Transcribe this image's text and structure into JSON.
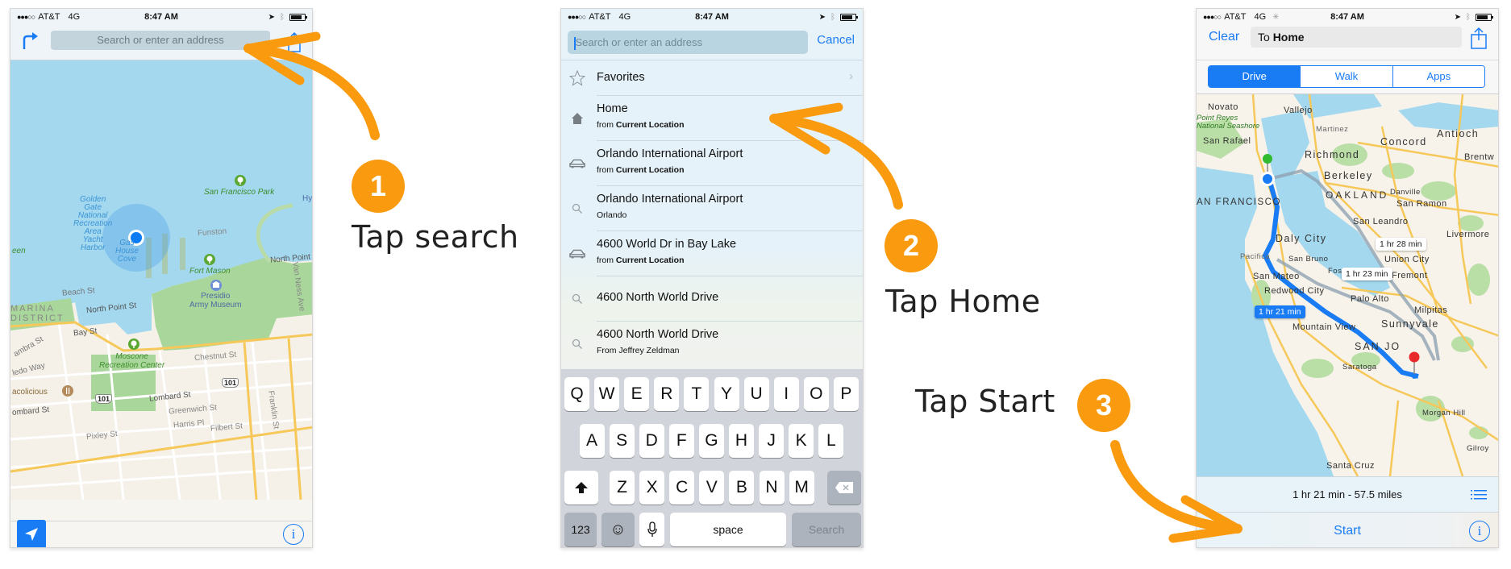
{
  "colors": {
    "accent_orange": "#f99a0f",
    "ios_blue": "#1a7cf5",
    "water": "#a3d8ef",
    "land": "#f7f3ea",
    "park": "#a9d69a",
    "road": "#f6c85a"
  },
  "status_bar": {
    "signal": "●●●○○",
    "carrier": "AT&T",
    "network": "4G",
    "time": "8:47 AM"
  },
  "steps": [
    {
      "number": "1",
      "label": "Tap search"
    },
    {
      "number": "2",
      "label": "Tap Home"
    },
    {
      "number": "3",
      "label": "Tap Start"
    }
  ],
  "screen1": {
    "search_placeholder": "Search or enter an address",
    "map_labels": {
      "golden_gate": "Golden Gate National Recreation Area Yacht Harbor",
      "golden_gate_lines": [
        "Golden",
        "Gate",
        "National",
        "Recreation",
        "Area",
        "Yacht",
        "Harbor"
      ],
      "gas_house_lines": [
        "Gas",
        "House",
        "Cove"
      ],
      "sf_park": "San Francisco Park",
      "funston": "Funston",
      "fort_mason": "Fort Mason",
      "museum_lines": [
        "Presidio",
        "Army Museum"
      ],
      "marina_lines": [
        "MARINA",
        "DISTRICT"
      ],
      "beach_st": "Beach St",
      "north_point_st": "North Point St",
      "north_point_st_2": "North Point St",
      "bay_st": "Bay St",
      "alhambra_st": "ambra St",
      "toledo_way": "ledo Way",
      "moscone_lines": [
        "Moscone",
        "Recreation Center"
      ],
      "chestnut_st": "Chestnut St",
      "tacolicious": "acolicious",
      "lombard_st": "Lombard St",
      "lombard_st_2": "ombard St",
      "greenwich_st": "Greenwich St",
      "harris_pl": "Harris Pl",
      "filbert_st": "Filbert St",
      "pixley_st": "Pixley St",
      "franklin_st": "Franklin St",
      "van_ness_ave": "Van Ness Ave",
      "hy": "Hy",
      "hwy_101": "101",
      "een": "een"
    }
  },
  "screen2": {
    "search_placeholder": "Search or enter an address",
    "cancel_label": "Cancel",
    "rows": [
      {
        "icon": "star",
        "title": "Favorites",
        "sub_prefix": "",
        "sub_bold": "",
        "chevron": true
      },
      {
        "icon": "home",
        "title": "Home",
        "sub_prefix": "from ",
        "sub_bold": "Current Location"
      },
      {
        "icon": "car",
        "title": "Orlando International Airport",
        "sub_prefix": "from ",
        "sub_bold": "Current Location"
      },
      {
        "icon": "search",
        "title": "Orlando International Airport",
        "sub_prefix": "Orlando",
        "sub_bold": ""
      },
      {
        "icon": "car",
        "title": "4600 World Dr in Bay Lake",
        "sub_prefix": "from ",
        "sub_bold": "Current Location"
      },
      {
        "icon": "search",
        "title": "4600 North World Drive",
        "sub_prefix": "",
        "sub_bold": ""
      },
      {
        "icon": "search",
        "title": "4600 North World Drive",
        "sub_prefix": "From Jeffrey Zeldman",
        "sub_bold": ""
      }
    ],
    "keyboard": {
      "row1": [
        "Q",
        "W",
        "E",
        "R",
        "T",
        "Y",
        "U",
        "I",
        "O",
        "P"
      ],
      "row2": [
        "A",
        "S",
        "D",
        "F",
        "G",
        "H",
        "J",
        "K",
        "L"
      ],
      "row3": [
        "Z",
        "X",
        "C",
        "V",
        "B",
        "N",
        "M"
      ],
      "numbers_label": "123",
      "space_label": "space",
      "search_label": "Search"
    }
  },
  "screen3": {
    "clear_label": "Clear",
    "route_prefix": "To ",
    "route_dest": "Home",
    "segments": [
      {
        "label": "Drive",
        "active": true
      },
      {
        "label": "Walk",
        "active": false
      },
      {
        "label": "Apps",
        "active": false
      }
    ],
    "cities": {
      "novato": "Novato",
      "vallejo": "Vallejo",
      "point_reyes": "Point Reyes",
      "national_seashore": "National Seashore",
      "san_rafael": "San Rafael",
      "martinez": "Martinez",
      "antioch": "Antioch",
      "concord": "Concord",
      "richmond": "Richmond",
      "brentwood": "Brentw",
      "berkeley": "Berkeley",
      "san_francisco": "AN FRANCISCO",
      "oakland": "OAKLAND",
      "danville": "Danville",
      "san_ramon": "San Ramon",
      "san_leandro": "San Leandro",
      "daly_city": "Daly City",
      "livermore": "Livermore",
      "pacifica": "Pacifica",
      "san_bruno": "San Bruno",
      "union_city": "Union City",
      "san_mateo": "San Mateo",
      "foster_city": "Foster City",
      "fremont": "Fremont",
      "redwood_city": "Redwood City",
      "palo_alto": "Palo Alto",
      "milpitas": "Milpitas",
      "mountain_view": "Mountain View",
      "sunnyvale": "Sunnyvale",
      "san_jose": "SAN JO",
      "saratoga": "Saratoga",
      "morgan_hill": "Morgan Hill",
      "gilroy": "Gilroy",
      "santa_cruz": "Santa Cruz"
    },
    "route_times": {
      "alt1": "1 hr 28 min",
      "alt2": "1 hr 23 min",
      "selected": "1 hr 21 min"
    },
    "summary": "1 hr 21 min - 57.5 miles",
    "start_label": "Start"
  }
}
